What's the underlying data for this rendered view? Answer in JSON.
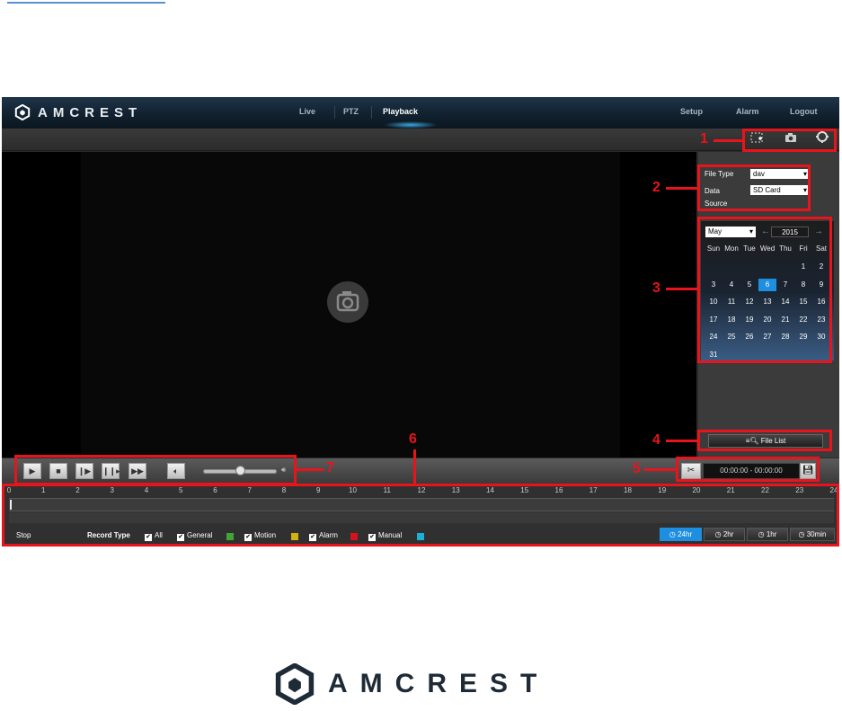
{
  "header": {
    "brand": "AMCREST",
    "nav": {
      "live": "Live",
      "ptz": "PTZ",
      "playback": "Playback",
      "setup": "Setup",
      "alarm": "Alarm",
      "logout": "Logout"
    }
  },
  "toolbar": {
    "icons": [
      "zoom-area-icon",
      "snapshot-icon",
      "fullscreen-icon"
    ]
  },
  "file_panel": {
    "file_type_label": "File Type",
    "file_type_value": "dav",
    "data_source_label_1": "Data",
    "data_source_label_2": "Source",
    "data_source_value": "SD Card"
  },
  "calendar": {
    "month": "May",
    "year": "2015",
    "weekdays": [
      "Sun",
      "Mon",
      "Tue",
      "Wed",
      "Thu",
      "Fri",
      "Sat"
    ],
    "days": [
      "1",
      "2",
      "3",
      "4",
      "5",
      "6",
      "7",
      "8",
      "9",
      "10",
      "11",
      "12",
      "13",
      "14",
      "15",
      "16",
      "17",
      "18",
      "19",
      "20",
      "21",
      "22",
      "23",
      "24",
      "25",
      "26",
      "27",
      "28",
      "29",
      "30",
      "31"
    ],
    "selected_day": "6"
  },
  "file_list_button": "File List",
  "clip": {
    "time_range": "00:00:00 - 00:00:00"
  },
  "timeline": {
    "ticks": [
      "0",
      "1",
      "2",
      "3",
      "4",
      "5",
      "6",
      "7",
      "8",
      "9",
      "10",
      "11",
      "12",
      "13",
      "14",
      "15",
      "16",
      "17",
      "18",
      "19",
      "20",
      "21",
      "22",
      "23",
      "24"
    ],
    "status": "Stop",
    "record_type_label": "Record Type",
    "types": [
      {
        "label": "All",
        "color": ""
      },
      {
        "label": "General",
        "color": "#3fa535"
      },
      {
        "label": "Motion",
        "color": "#d4b20f"
      },
      {
        "label": "Alarm",
        "color": "#d6131b"
      },
      {
        "label": "Manual",
        "color": "#1ab0d8"
      }
    ],
    "zoom": [
      "24hr",
      "2hr",
      "1hr",
      "30min"
    ]
  },
  "callouts": [
    "1",
    "2",
    "3",
    "4",
    "5",
    "6",
    "7"
  ],
  "colors": {
    "accent": "#1e8fe0",
    "callout": "#e8141b"
  },
  "footer": {
    "brand": "AMCREST"
  }
}
